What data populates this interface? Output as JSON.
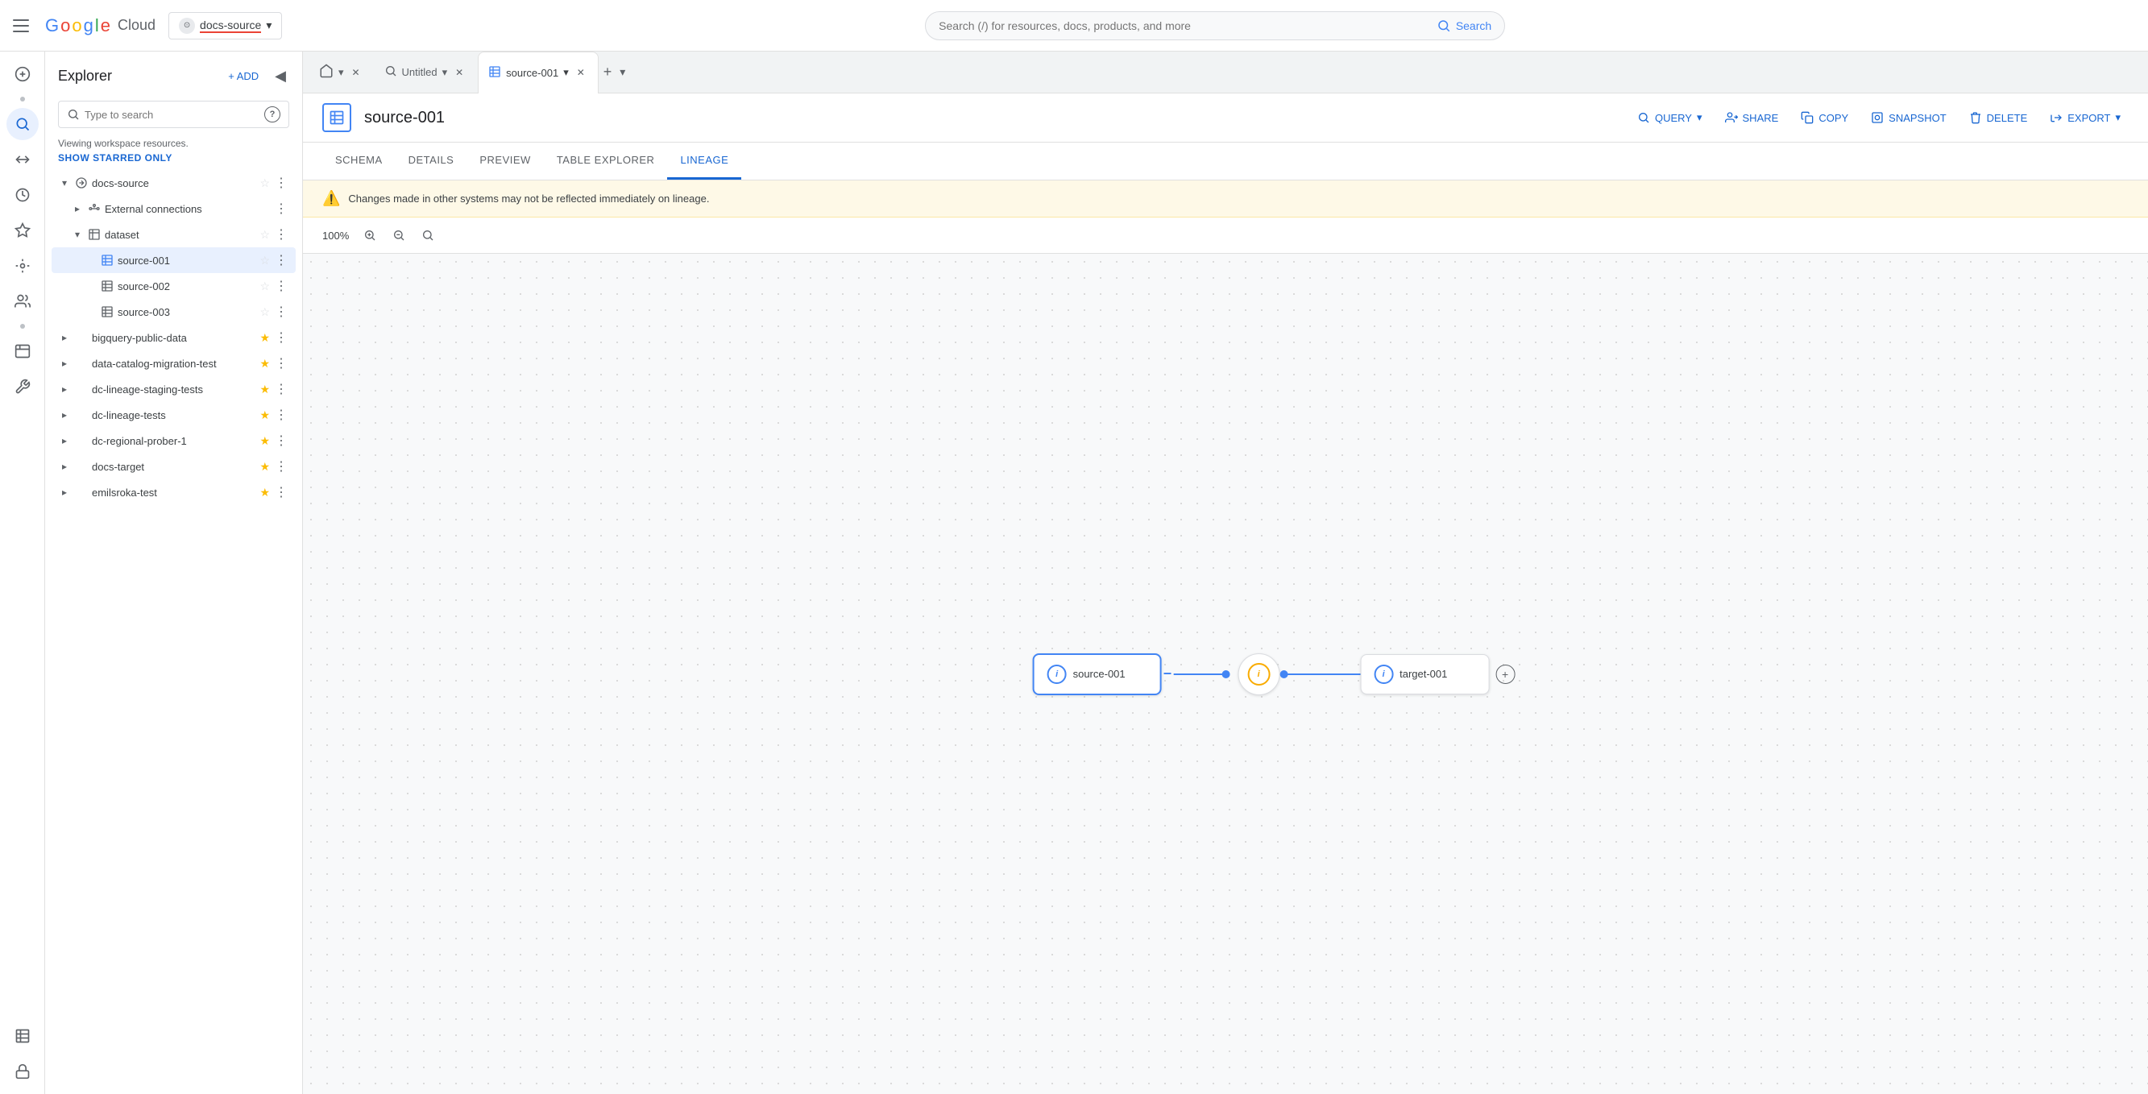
{
  "topbar": {
    "project_name": "docs-source",
    "search_placeholder": "Search (/) for resources, docs, products, and more",
    "search_label": "Search"
  },
  "explorer": {
    "title": "Explorer",
    "add_label": "+ ADD",
    "search_placeholder": "Type to search",
    "workspace_text": "Viewing workspace resources.",
    "show_starred_label": "SHOW STARRED ONLY",
    "tree": [
      {
        "label": "docs-source",
        "type": "project",
        "expanded": true,
        "starred": false,
        "indent": 0,
        "children": [
          {
            "label": "External connections",
            "type": "connection",
            "expanded": false,
            "starred": false,
            "indent": 1
          },
          {
            "label": "dataset",
            "type": "dataset",
            "expanded": true,
            "starred": false,
            "indent": 1,
            "children": [
              {
                "label": "source-001",
                "type": "table",
                "active": true,
                "starred": false,
                "indent": 2
              },
              {
                "label": "source-002",
                "type": "table",
                "active": false,
                "starred": false,
                "indent": 2
              },
              {
                "label": "source-003",
                "type": "table",
                "active": false,
                "starred": false,
                "indent": 2
              }
            ]
          }
        ]
      },
      {
        "label": "bigquery-public-data",
        "type": "project",
        "expanded": false,
        "starred": true,
        "indent": 0
      },
      {
        "label": "data-catalog-migration-test",
        "type": "project",
        "expanded": false,
        "starred": true,
        "indent": 0
      },
      {
        "label": "dc-lineage-staging-tests",
        "type": "project",
        "expanded": false,
        "starred": true,
        "indent": 0
      },
      {
        "label": "dc-lineage-tests",
        "type": "project",
        "expanded": false,
        "starred": true,
        "indent": 0
      },
      {
        "label": "dc-regional-prober-1",
        "type": "project",
        "expanded": false,
        "starred": true,
        "indent": 0
      },
      {
        "label": "docs-target",
        "type": "project",
        "expanded": false,
        "starred": true,
        "indent": 0
      },
      {
        "label": "emilsroka-test",
        "type": "project",
        "expanded": false,
        "starred": true,
        "indent": 0
      }
    ]
  },
  "tabs": [
    {
      "id": "home",
      "type": "home",
      "label": "",
      "closeable": false,
      "active": false
    },
    {
      "id": "untitled",
      "type": "query",
      "label": "Untitled",
      "closeable": true,
      "active": false
    },
    {
      "id": "source-001",
      "type": "table",
      "label": "source-001",
      "closeable": true,
      "active": true
    }
  ],
  "table": {
    "icon": "⊞",
    "title": "source-001",
    "actions": [
      {
        "id": "query",
        "label": "QUERY",
        "icon": "🔍",
        "has_dropdown": true
      },
      {
        "id": "share",
        "label": "SHARE",
        "icon": "👤",
        "has_dropdown": false
      },
      {
        "id": "copy",
        "label": "COPY",
        "icon": "📋",
        "has_dropdown": false
      },
      {
        "id": "snapshot",
        "label": "SNAPSHOT",
        "icon": "📷",
        "has_dropdown": false
      },
      {
        "id": "delete",
        "label": "DELETE",
        "icon": "🗑",
        "has_dropdown": false
      },
      {
        "id": "export",
        "label": "EXPORT",
        "icon": "⬆",
        "has_dropdown": true
      }
    ],
    "subtabs": [
      {
        "id": "schema",
        "label": "SCHEMA"
      },
      {
        "id": "details",
        "label": "DETAILS"
      },
      {
        "id": "preview",
        "label": "PREVIEW"
      },
      {
        "id": "table-explorer",
        "label": "TABLE EXPLORER"
      },
      {
        "id": "lineage",
        "label": "LINEAGE",
        "active": true
      }
    ]
  },
  "lineage": {
    "warning": "Changes made in other systems may not be reflected immediately on lineage.",
    "zoom": "100%",
    "nodes": [
      {
        "id": "source-001",
        "label": "source-001",
        "type": "table"
      },
      {
        "id": "process",
        "label": "",
        "type": "process"
      },
      {
        "id": "target-001",
        "label": "target-001",
        "type": "table"
      }
    ]
  },
  "icons": {
    "hamburger": "☰",
    "search": "🔍",
    "pin": "📌",
    "home": "⌂",
    "close": "✕",
    "add": "+",
    "dropdown_arrow": "▾",
    "star_filled": "★",
    "star_empty": "☆",
    "more": "⋮",
    "collapse": "◀",
    "help": "?",
    "zoom_in": "+",
    "zoom_out": "−",
    "zoom_reset": "⊙",
    "table_icon": "⊞",
    "info": "i"
  }
}
